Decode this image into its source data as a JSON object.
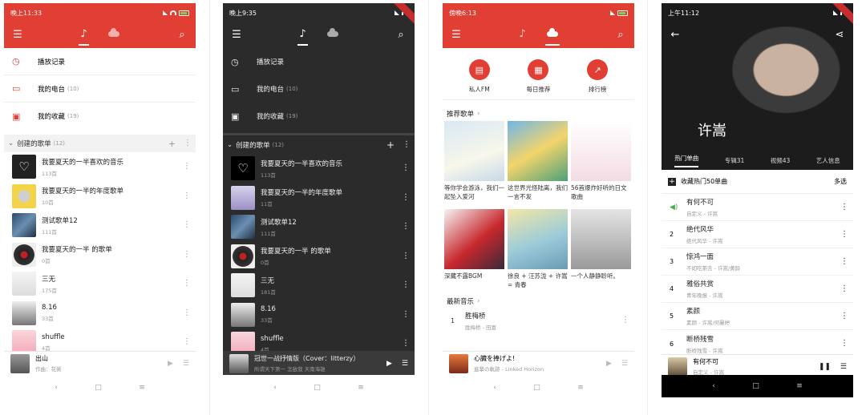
{
  "colors": {
    "accent": "#e13e34",
    "dark_bg": "#2b2b2b"
  },
  "screen1": {
    "time": "晚上11:33",
    "menu": [
      {
        "label": "播放记录",
        "count": "",
        "icon": "clock-icon"
      },
      {
        "label": "我的电台",
        "count": "(10)",
        "icon": "cast-icon"
      },
      {
        "label": "我的收藏",
        "count": "(19)",
        "icon": "collection-icon"
      }
    ],
    "section": {
      "title": "创建的歌单",
      "count": "(12)"
    },
    "playlists": [
      {
        "title": "我要夏天的一半喜欢的音乐",
        "sub": "113首"
      },
      {
        "title": "我要夏天的一半的年度歌单",
        "sub": "10首"
      },
      {
        "title": "测试歌单12",
        "sub": "111首"
      },
      {
        "title": "我要夏天的一半 的歌单",
        "sub": "0首"
      },
      {
        "title": "三无",
        "sub": "175首"
      },
      {
        "title": "8.16",
        "sub": "33首"
      },
      {
        "title": "shuffle",
        "sub": "4首"
      }
    ],
    "player": {
      "title": "出山",
      "sub": "作曲：花粥"
    }
  },
  "screen2": {
    "time": "晚上9:35",
    "menu": [
      {
        "label": "播放记录",
        "count": ""
      },
      {
        "label": "我的电台",
        "count": "(10)"
      },
      {
        "label": "我的收藏",
        "count": "(19)"
      }
    ],
    "section": {
      "title": "创建的歌单",
      "count": "(12)"
    },
    "playlists": [
      {
        "title": "我要夏天的一半喜欢的音乐",
        "sub": "113首"
      },
      {
        "title": "我要夏天的一半的年度歌单",
        "sub": "11首"
      },
      {
        "title": "测试歌单12",
        "sub": "111首"
      },
      {
        "title": "我要夏天的一半 的歌单",
        "sub": "0首"
      },
      {
        "title": "三无",
        "sub": "181首"
      },
      {
        "title": "8.16",
        "sub": "33首"
      },
      {
        "title": "shuffle",
        "sub": "4首"
      }
    ],
    "player": {
      "title": "冠世一战抒情版（Cover：litterzy）",
      "sub": "所谓天下第一 怎敌我 天南海雄"
    }
  },
  "screen3": {
    "time": "傍晚6:13",
    "circles": [
      {
        "label": "私人FM",
        "icon": "radio-icon"
      },
      {
        "label": "每日推荐",
        "icon": "calendar-icon"
      },
      {
        "label": "排行榜",
        "icon": "chart-icon"
      }
    ],
    "rec_title": "推荐歌单",
    "rec": [
      "等你学会游泳，我们一起坠入爱河",
      "这世界光怪陆离，我们一言不发",
      "56首爆炸好听的日文歌曲",
      "深藏不露BGM",
      "徐良 + 汪苏泷 + 许嵩 = 青春",
      "一个人静静聆听。"
    ],
    "new_title": "最新音乐",
    "new_song": {
      "num": "1",
      "title": "胜梅桥",
      "sub": "胜梅桥 - 田富"
    },
    "player": {
      "title": "心臓を捧げよ!",
      "sub": "進撃の軌跡 - Linked Horizon"
    }
  },
  "screen4": {
    "time": "上午11:12",
    "artist": "许嵩",
    "tabs": [
      "热门单曲",
      "专辑31",
      "视频43",
      "艺人信息"
    ],
    "collect": "收藏热门50单曲",
    "multi": "多选",
    "songs": [
      {
        "num": "",
        "title": "有何不可",
        "sub": "自定义 - 许嵩"
      },
      {
        "num": "2",
        "title": "绝代风华",
        "sub": "绝代风华 - 许嵩"
      },
      {
        "num": "3",
        "title": "惊鸿一面",
        "sub": "不如吃茶去 - 许嵩/黄龄"
      },
      {
        "num": "4",
        "title": "雅俗共赏",
        "sub": "青年晚报 - 许嵩"
      },
      {
        "num": "5",
        "title": "素颜",
        "sub": "素颜 - 许嵩/何曼婷"
      },
      {
        "num": "6",
        "title": "断桥残雪",
        "sub": "断桥残雪 - 许嵩"
      }
    ],
    "player": {
      "title": "有何不可",
      "sub": "自定义 - 许嵩"
    }
  }
}
